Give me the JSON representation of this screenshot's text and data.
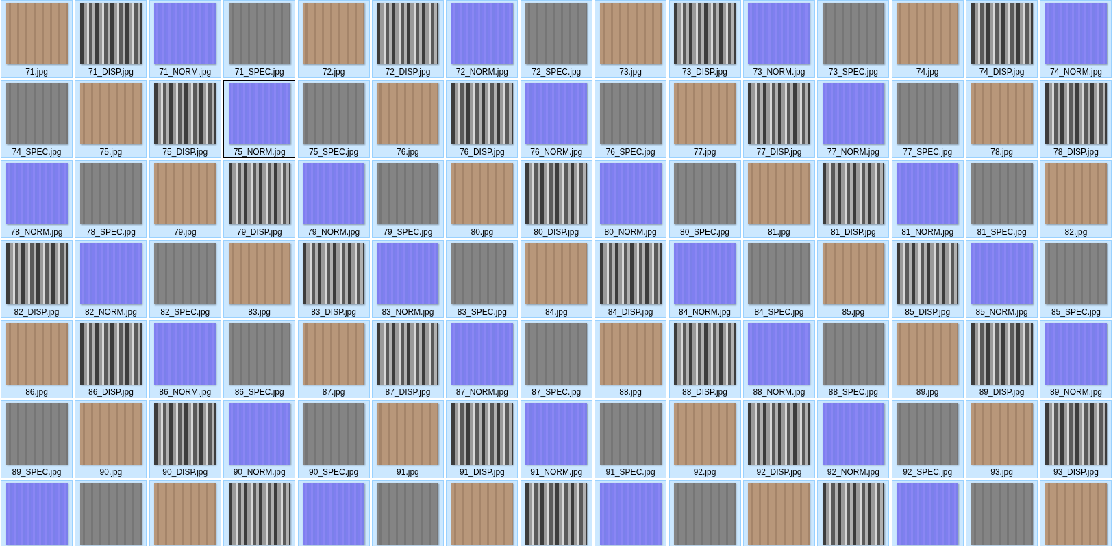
{
  "items": [
    {
      "label": "71.jpg",
      "kind": "diffuse",
      "selected": true,
      "focused": false
    },
    {
      "label": "71_DISP.jpg",
      "kind": "disp",
      "selected": true,
      "focused": false
    },
    {
      "label": "71_NORM.jpg",
      "kind": "norm",
      "selected": true,
      "focused": false
    },
    {
      "label": "71_SPEC.jpg",
      "kind": "spec",
      "selected": true,
      "focused": false
    },
    {
      "label": "72.jpg",
      "kind": "diffuse",
      "selected": true,
      "focused": false
    },
    {
      "label": "72_DISP.jpg",
      "kind": "disp",
      "selected": true,
      "focused": false
    },
    {
      "label": "72_NORM.jpg",
      "kind": "norm",
      "selected": true,
      "focused": false
    },
    {
      "label": "72_SPEC.jpg",
      "kind": "spec",
      "selected": true,
      "focused": false
    },
    {
      "label": "73.jpg",
      "kind": "diffuse",
      "selected": true,
      "focused": false
    },
    {
      "label": "73_DISP.jpg",
      "kind": "disp",
      "selected": true,
      "focused": false
    },
    {
      "label": "73_NORM.jpg",
      "kind": "norm",
      "selected": true,
      "focused": false
    },
    {
      "label": "73_SPEC.jpg",
      "kind": "spec",
      "selected": true,
      "focused": false
    },
    {
      "label": "74.jpg",
      "kind": "diffuse",
      "selected": true,
      "focused": false
    },
    {
      "label": "74_DISP.jpg",
      "kind": "disp",
      "selected": true,
      "focused": false
    },
    {
      "label": "74_NORM.jpg",
      "kind": "norm",
      "selected": true,
      "focused": false
    },
    {
      "label": "74_SPEC.jpg",
      "kind": "spec",
      "selected": true,
      "focused": false
    },
    {
      "label": "75.jpg",
      "kind": "diffuse",
      "selected": true,
      "focused": false
    },
    {
      "label": "75_DISP.jpg",
      "kind": "disp",
      "selected": true,
      "focused": false
    },
    {
      "label": "75_NORM.jpg",
      "kind": "norm",
      "selected": true,
      "focused": true
    },
    {
      "label": "75_SPEC.jpg",
      "kind": "spec",
      "selected": true,
      "focused": false
    },
    {
      "label": "76.jpg",
      "kind": "diffuse",
      "selected": true,
      "focused": false
    },
    {
      "label": "76_DISP.jpg",
      "kind": "disp",
      "selected": true,
      "focused": false
    },
    {
      "label": "76_NORM.jpg",
      "kind": "norm",
      "selected": true,
      "focused": false
    },
    {
      "label": "76_SPEC.jpg",
      "kind": "spec",
      "selected": true,
      "focused": false
    },
    {
      "label": "77.jpg",
      "kind": "diffuse",
      "selected": true,
      "focused": false
    },
    {
      "label": "77_DISP.jpg",
      "kind": "disp",
      "selected": true,
      "focused": false
    },
    {
      "label": "77_NORM.jpg",
      "kind": "norm",
      "selected": true,
      "focused": false
    },
    {
      "label": "77_SPEC.jpg",
      "kind": "spec",
      "selected": true,
      "focused": false
    },
    {
      "label": "78.jpg",
      "kind": "diffuse",
      "selected": true,
      "focused": false
    },
    {
      "label": "78_DISP.jpg",
      "kind": "disp",
      "selected": true,
      "focused": false
    },
    {
      "label": "78_NORM.jpg",
      "kind": "norm",
      "selected": true,
      "focused": false
    },
    {
      "label": "78_SPEC.jpg",
      "kind": "spec",
      "selected": true,
      "focused": false
    },
    {
      "label": "79.jpg",
      "kind": "diffuse",
      "selected": true,
      "focused": false
    },
    {
      "label": "79_DISP.jpg",
      "kind": "disp",
      "selected": true,
      "focused": false
    },
    {
      "label": "79_NORM.jpg",
      "kind": "norm",
      "selected": true,
      "focused": false
    },
    {
      "label": "79_SPEC.jpg",
      "kind": "spec",
      "selected": true,
      "focused": false
    },
    {
      "label": "80.jpg",
      "kind": "diffuse",
      "selected": true,
      "focused": false
    },
    {
      "label": "80_DISP.jpg",
      "kind": "disp",
      "selected": true,
      "focused": false
    },
    {
      "label": "80_NORM.jpg",
      "kind": "norm",
      "selected": true,
      "focused": false
    },
    {
      "label": "80_SPEC.jpg",
      "kind": "spec",
      "selected": true,
      "focused": false
    },
    {
      "label": "81.jpg",
      "kind": "diffuse",
      "selected": true,
      "focused": false
    },
    {
      "label": "81_DISP.jpg",
      "kind": "disp",
      "selected": true,
      "focused": false
    },
    {
      "label": "81_NORM.jpg",
      "kind": "norm",
      "selected": true,
      "focused": false
    },
    {
      "label": "81_SPEC.jpg",
      "kind": "spec",
      "selected": true,
      "focused": false
    },
    {
      "label": "82.jpg",
      "kind": "diffuse",
      "selected": true,
      "focused": false
    },
    {
      "label": "82_DISP.jpg",
      "kind": "disp",
      "selected": true,
      "focused": false
    },
    {
      "label": "82_NORM.jpg",
      "kind": "norm",
      "selected": true,
      "focused": false
    },
    {
      "label": "82_SPEC.jpg",
      "kind": "spec",
      "selected": true,
      "focused": false
    },
    {
      "label": "83.jpg",
      "kind": "diffuse",
      "selected": true,
      "focused": false
    },
    {
      "label": "83_DISP.jpg",
      "kind": "disp",
      "selected": true,
      "focused": false
    },
    {
      "label": "83_NORM.jpg",
      "kind": "norm",
      "selected": true,
      "focused": false
    },
    {
      "label": "83_SPEC.jpg",
      "kind": "spec",
      "selected": true,
      "focused": false
    },
    {
      "label": "84.jpg",
      "kind": "diffuse",
      "selected": true,
      "focused": false
    },
    {
      "label": "84_DISP.jpg",
      "kind": "disp",
      "selected": true,
      "focused": false
    },
    {
      "label": "84_NORM.jpg",
      "kind": "norm",
      "selected": true,
      "focused": false
    },
    {
      "label": "84_SPEC.jpg",
      "kind": "spec",
      "selected": true,
      "focused": false
    },
    {
      "label": "85.jpg",
      "kind": "diffuse",
      "selected": true,
      "focused": false
    },
    {
      "label": "85_DISP.jpg",
      "kind": "disp",
      "selected": true,
      "focused": false
    },
    {
      "label": "85_NORM.jpg",
      "kind": "norm",
      "selected": true,
      "focused": false
    },
    {
      "label": "85_SPEC.jpg",
      "kind": "spec",
      "selected": true,
      "focused": false
    },
    {
      "label": "86.jpg",
      "kind": "diffuse",
      "selected": true,
      "focused": false
    },
    {
      "label": "86_DISP.jpg",
      "kind": "disp",
      "selected": true,
      "focused": false
    },
    {
      "label": "86_NORM.jpg",
      "kind": "norm",
      "selected": true,
      "focused": false
    },
    {
      "label": "86_SPEC.jpg",
      "kind": "spec",
      "selected": true,
      "focused": false
    },
    {
      "label": "87.jpg",
      "kind": "diffuse",
      "selected": true,
      "focused": false
    },
    {
      "label": "87_DISP.jpg",
      "kind": "disp",
      "selected": true,
      "focused": false
    },
    {
      "label": "87_NORM.jpg",
      "kind": "norm",
      "selected": true,
      "focused": false
    },
    {
      "label": "87_SPEC.jpg",
      "kind": "spec",
      "selected": true,
      "focused": false
    },
    {
      "label": "88.jpg",
      "kind": "diffuse",
      "selected": true,
      "focused": false
    },
    {
      "label": "88_DISP.jpg",
      "kind": "disp",
      "selected": true,
      "focused": false
    },
    {
      "label": "88_NORM.jpg",
      "kind": "norm",
      "selected": true,
      "focused": false
    },
    {
      "label": "88_SPEC.jpg",
      "kind": "spec",
      "selected": true,
      "focused": false
    },
    {
      "label": "89.jpg",
      "kind": "diffuse",
      "selected": true,
      "focused": false
    },
    {
      "label": "89_DISP.jpg",
      "kind": "disp",
      "selected": true,
      "focused": false
    },
    {
      "label": "89_NORM.jpg",
      "kind": "norm",
      "selected": true,
      "focused": false
    },
    {
      "label": "89_SPEC.jpg",
      "kind": "spec",
      "selected": true,
      "focused": false
    },
    {
      "label": "90.jpg",
      "kind": "diffuse",
      "selected": true,
      "focused": false
    },
    {
      "label": "90_DISP.jpg",
      "kind": "disp",
      "selected": true,
      "focused": false
    },
    {
      "label": "90_NORM.jpg",
      "kind": "norm",
      "selected": true,
      "focused": false
    },
    {
      "label": "90_SPEC.jpg",
      "kind": "spec",
      "selected": true,
      "focused": false
    },
    {
      "label": "91.jpg",
      "kind": "diffuse",
      "selected": true,
      "focused": false
    },
    {
      "label": "91_DISP.jpg",
      "kind": "disp",
      "selected": true,
      "focused": false
    },
    {
      "label": "91_NORM.jpg",
      "kind": "norm",
      "selected": true,
      "focused": false
    },
    {
      "label": "91_SPEC.jpg",
      "kind": "spec",
      "selected": true,
      "focused": false
    },
    {
      "label": "92.jpg",
      "kind": "diffuse",
      "selected": true,
      "focused": false
    },
    {
      "label": "92_DISP.jpg",
      "kind": "disp",
      "selected": true,
      "focused": false
    },
    {
      "label": "92_NORM.jpg",
      "kind": "norm",
      "selected": true,
      "focused": false
    },
    {
      "label": "92_SPEC.jpg",
      "kind": "spec",
      "selected": true,
      "focused": false
    },
    {
      "label": "93.jpg",
      "kind": "diffuse",
      "selected": true,
      "focused": false
    },
    {
      "label": "93_DISP.jpg",
      "kind": "disp",
      "selected": true,
      "focused": false
    },
    {
      "kind": "norm",
      "selected": true,
      "focused": false
    },
    {
      "kind": "spec",
      "selected": true,
      "focused": false
    },
    {
      "kind": "diffuse",
      "selected": true,
      "focused": false
    },
    {
      "kind": "disp",
      "selected": true,
      "focused": false
    },
    {
      "kind": "norm",
      "selected": true,
      "focused": false
    },
    {
      "kind": "spec",
      "selected": true,
      "focused": false
    },
    {
      "kind": "diffuse",
      "selected": true,
      "focused": false
    },
    {
      "kind": "disp",
      "selected": true,
      "focused": false
    },
    {
      "kind": "norm",
      "selected": true,
      "focused": false
    },
    {
      "kind": "spec",
      "selected": true,
      "focused": false
    },
    {
      "kind": "diffuse",
      "selected": true,
      "focused": false
    },
    {
      "kind": "disp",
      "selected": true,
      "focused": false
    },
    {
      "kind": "norm",
      "selected": true,
      "focused": false
    },
    {
      "kind": "spec",
      "selected": true,
      "focused": false
    },
    {
      "kind": "diffuse",
      "selected": true,
      "focused": false
    }
  ]
}
